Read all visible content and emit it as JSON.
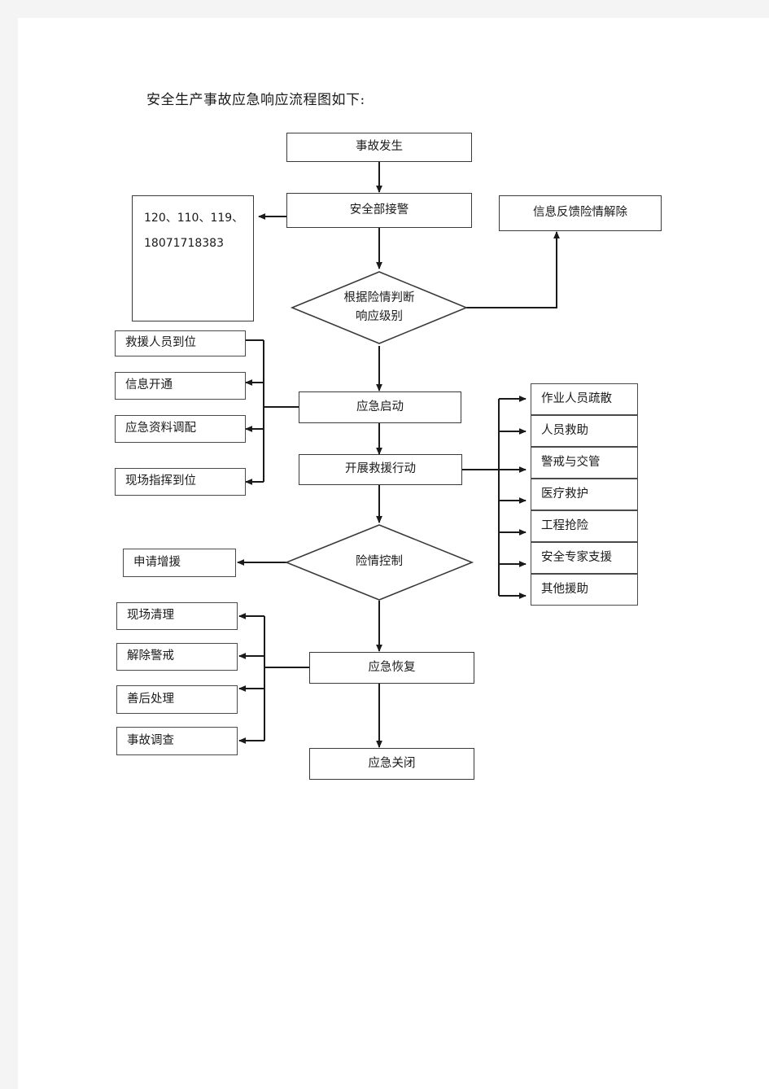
{
  "document": {
    "title": "安全生产事故应急响应流程图如下:"
  },
  "flowchart": {
    "type": "flowchart",
    "nodes": {
      "accident_occurs": {
        "label": "事故发生",
        "shape": "box"
      },
      "safety_dept_receives": {
        "label": "安全部接警",
        "shape": "box"
      },
      "emergency_numbers": {
        "label": "120、110、119、\n18071718383",
        "shape": "box"
      },
      "info_feedback": {
        "label": "信息反馈险情解除",
        "shape": "box"
      },
      "judge_level": {
        "label": "根据险情判断\n响应级别",
        "shape": "diamond"
      },
      "emergency_start": {
        "label": "应急启动",
        "shape": "box"
      },
      "rescue_action": {
        "label": "开展救援行动",
        "shape": "box"
      },
      "danger_controlled": {
        "label": "险情控制",
        "shape": "diamond"
      },
      "request_support": {
        "label": "申请增援",
        "shape": "box"
      },
      "emergency_recovery": {
        "label": "应急恢复",
        "shape": "box"
      },
      "emergency_close": {
        "label": "应急关闭",
        "shape": "box"
      }
    },
    "start_group": {
      "items": [
        {
          "label": "救援人员到位"
        },
        {
          "label": "信息开通"
        },
        {
          "label": "应急资料调配"
        },
        {
          "label": "现场指挥到位"
        }
      ]
    },
    "rescue_group": {
      "items": [
        {
          "label": "作业人员疏散"
        },
        {
          "label": "人员救助"
        },
        {
          "label": "警戒与交管"
        },
        {
          "label": "医疗救护"
        },
        {
          "label": "工程抢险"
        },
        {
          "label": "安全专家支援"
        },
        {
          "label": "其他援助"
        }
      ]
    },
    "recovery_group": {
      "items": [
        {
          "label": "现场清理"
        },
        {
          "label": "解除警戒"
        },
        {
          "label": "善后处理"
        },
        {
          "label": "事故调查"
        }
      ]
    },
    "colors": {
      "page_background": "#f4f4f4",
      "sheet": "#ffffff",
      "stroke": "#3a3a3a",
      "text": "#1a1a1a"
    }
  }
}
